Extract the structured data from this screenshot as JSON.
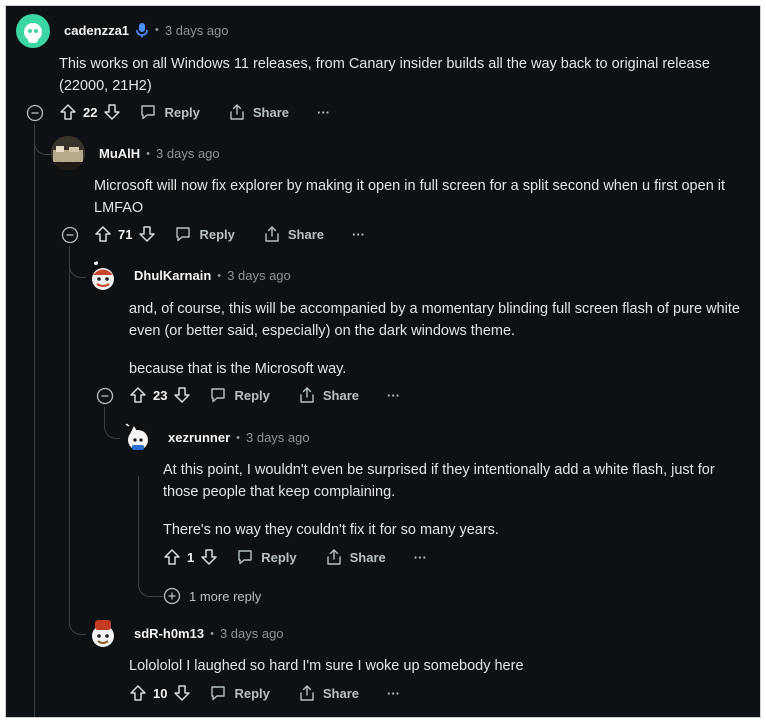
{
  "comments": [
    {
      "username": "cadenzza1",
      "time": "3 days ago",
      "text_lines": [
        "This works on all Windows 11 releases, from Canary insider builds all the way back to original release",
        "(22000, 21H2)"
      ],
      "votes": "22",
      "has_mic_badge": true
    },
    {
      "username": "MuAlH",
      "time": "3 days ago",
      "text_lines": [
        "Microsoft will now fix explorer by making it open in full screen for a split second when u first open it",
        "LMFAO"
      ],
      "votes": "71"
    },
    {
      "username": "DhulKarnain",
      "time": "3 days ago",
      "text_lines": [
        "and, of course, this will be accompanied by a momentary blinding full screen flash of pure white",
        "even (or better said, especially) on the dark windows theme.",
        "because that is the Microsoft way."
      ],
      "votes": "23"
    },
    {
      "username": "xezrunner",
      "time": "3 days ago",
      "text_lines": [
        "At this point, I wouldn't even be surprised if they intentionally add a white flash, just for",
        "those people that keep complaining.",
        "There's no way they couldn't fix it for so many years."
      ],
      "votes": "1"
    },
    {
      "username": "sdR-h0m13",
      "time": "3 days ago",
      "text_lines": [
        "Lolololol I laughed so hard I'm sure I woke up somebody here"
      ],
      "votes": "10"
    }
  ],
  "labels": {
    "separator": "•",
    "reply": "Reply",
    "share": "Share",
    "more": "···",
    "more_replies": "1 more reply"
  },
  "icons": [
    "upvote-icon",
    "downvote-icon",
    "reply-icon",
    "share-icon",
    "collapse-icon",
    "expand-icon",
    "microphone-icon"
  ],
  "colors": {
    "background": "#0e1113",
    "text": "#e3e6e8",
    "muted": "#8b9499",
    "thread_line": "#3b4246",
    "avatar_green": "#3bd6a3",
    "mic_blue": "#4a90ff"
  }
}
